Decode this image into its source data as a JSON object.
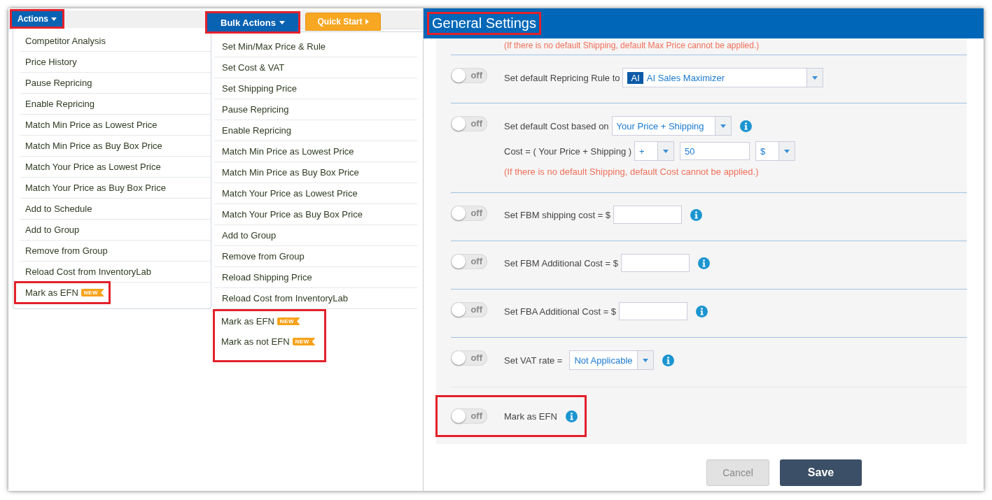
{
  "actions_menu": {
    "button": {
      "label": "Actions",
      "highlighted": true
    },
    "items": [
      {
        "label": "Competitor Analysis",
        "highlighted": false
      },
      {
        "label": "Price History",
        "highlighted": false
      },
      {
        "label": "Pause Repricing",
        "highlighted": false
      },
      {
        "label": "Enable Repricing",
        "highlighted": false
      },
      {
        "label": "Match Min Price as Lowest Price",
        "highlighted": false
      },
      {
        "label": "Match Min Price as Buy Box Price",
        "highlighted": false
      },
      {
        "label": "Match Your Price as Lowest Price",
        "highlighted": false
      },
      {
        "label": "Match Your Price as Buy Box Price",
        "highlighted": false
      },
      {
        "label": "Add to Schedule",
        "highlighted": false
      },
      {
        "label": "Add to Group",
        "highlighted": false
      },
      {
        "label": "Remove from Group",
        "highlighted": false
      },
      {
        "label": "Reload Cost from InventoryLab",
        "highlighted": false
      },
      {
        "label": "Mark as EFN",
        "badge": "NEW",
        "highlighted": true
      }
    ]
  },
  "bulk_actions": {
    "button": {
      "label": "Bulk Actions",
      "highlighted": true
    },
    "items": [
      {
        "label": "Set Min/Max Price & Rule",
        "highlighted": false
      },
      {
        "label": "Set Cost & VAT",
        "highlighted": false
      },
      {
        "label": "Set Shipping Price",
        "highlighted": false
      },
      {
        "label": "Pause Repricing",
        "highlighted": false
      },
      {
        "label": "Enable Repricing",
        "highlighted": false
      },
      {
        "label": "Match Min Price as Lowest Price",
        "highlighted": false
      },
      {
        "label": "Match Min Price as Buy Box Price",
        "highlighted": false
      },
      {
        "label": "Match Your Price as Lowest Price",
        "highlighted": false
      },
      {
        "label": "Match Your Price as Buy Box Price",
        "highlighted": false
      },
      {
        "label": "Add to Group",
        "highlighted": false
      },
      {
        "label": "Remove from Group",
        "highlighted": false
      },
      {
        "label": "Reload Shipping Price",
        "highlighted": false
      },
      {
        "label": "Reload Cost from InventoryLab",
        "highlighted": false
      },
      {
        "label": "Mark as EFN",
        "badge": "NEW",
        "highlighted": true
      },
      {
        "label": "Mark as not EFN",
        "badge": "NEW",
        "highlighted": true
      }
    ]
  },
  "quick_start": {
    "label": "Quick Start"
  },
  "settings": {
    "title": "General Settings",
    "title_highlighted": true,
    "top_note": "(If there is no default Shipping, default Max Price cannot be applied.)",
    "rows": [
      {
        "kind": "select",
        "on": false,
        "toggle_text": "off",
        "label": "Set default Repricing Rule to",
        "select": {
          "tag": "AI",
          "value": "AI Sales Maximizer"
        },
        "info": false,
        "highlighted": false
      },
      {
        "kind": "cost",
        "on": false,
        "toggle_text": "off",
        "label": "Set default Cost based on",
        "select": {
          "value": "Your Price + Shipping"
        },
        "info": true,
        "formula_label": "Cost = ( Your Price + Shipping )",
        "operator": "+",
        "amount": "50",
        "unit": "$",
        "note": "(If there is no default Shipping, default Cost cannot be applied.)",
        "highlighted": false
      },
      {
        "kind": "input",
        "on": false,
        "toggle_text": "off",
        "label": "Set FBM shipping cost = $",
        "info": true,
        "highlighted": false
      },
      {
        "kind": "input",
        "on": false,
        "toggle_text": "off",
        "label": "Set FBM Additional Cost = $",
        "info": true,
        "highlighted": false
      },
      {
        "kind": "input",
        "on": false,
        "toggle_text": "off",
        "label": "Set FBA Additional Cost = $",
        "info": true,
        "highlighted": false
      },
      {
        "kind": "select",
        "on": false,
        "toggle_text": "off",
        "label": "Set VAT rate =",
        "select": {
          "value": "Not Applicable"
        },
        "info": true,
        "highlighted": false
      },
      {
        "kind": "plain",
        "on": false,
        "toggle_text": "off",
        "label": "Mark as EFN",
        "info": true,
        "highlighted": true
      }
    ]
  },
  "buttons": [
    {
      "label": "Cancel",
      "disabled": true
    },
    {
      "label": "Save",
      "disabled": false
    }
  ]
}
